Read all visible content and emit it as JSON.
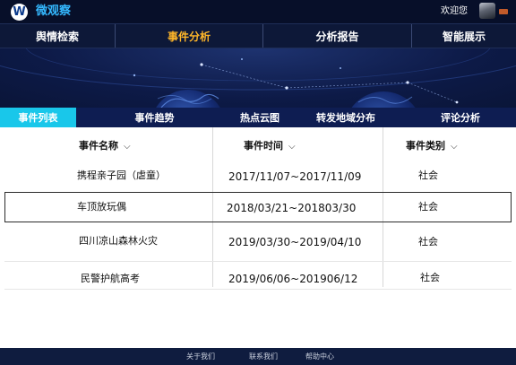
{
  "header": {
    "logo_letter": "W",
    "app_title": "微观察",
    "welcome_text": "欢迎您"
  },
  "main_nav": [
    {
      "label": "舆情检索"
    },
    {
      "label": "事件分析",
      "active": true
    },
    {
      "label": "分析报告"
    },
    {
      "label": "智能展示"
    }
  ],
  "sub_tabs": [
    {
      "label": "事件列表",
      "active": true
    },
    {
      "label": "事件趋势"
    },
    {
      "label": "热点云图"
    },
    {
      "label": "转发地域分布"
    },
    {
      "label": "评论分析"
    }
  ],
  "table": {
    "columns": [
      "事件名称",
      "事件时间",
      "事件类别"
    ],
    "rows": [
      {
        "name": "携程亲子园（虐童）",
        "time": "2017/11/07~2017/11/09",
        "category": "社会"
      },
      {
        "name": "车顶放玩偶",
        "time": "2018/03/21~201803/30",
        "category": "社会",
        "selected": true
      },
      {
        "name": "四川凉山森林火灾",
        "time": "2019/03/30~2019/04/10",
        "category": "社会"
      },
      {
        "name": "民警护航高考",
        "time": "2019/06/06~201906/12",
        "category": "社会"
      }
    ]
  },
  "footer": {
    "links": [
      "关于我们",
      "联系我们",
      "帮助中心"
    ]
  },
  "colors": {
    "accent_active_nav": "#ffb629",
    "active_subtab": "#19c7ea",
    "logo_text": "#34b8ff",
    "background": "#0b1636"
  },
  "icons": [
    "wordpress-logo-icon",
    "chevron-down-icon",
    "globe-graphic"
  ]
}
